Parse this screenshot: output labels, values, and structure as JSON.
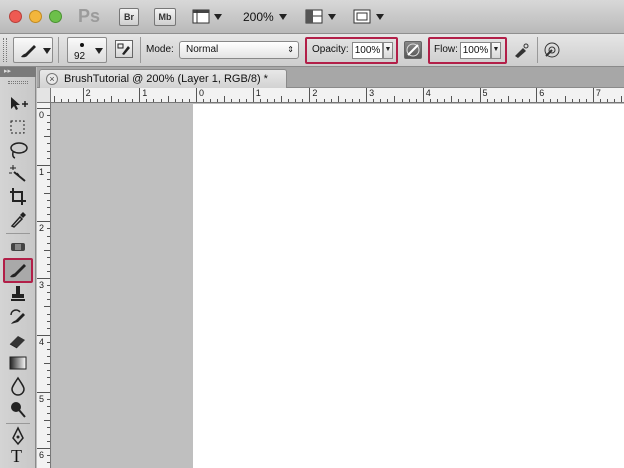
{
  "app": {
    "logo": "Ps",
    "bridge_label": "Br",
    "minibridge_label": "Mb",
    "zoom_level": "200%"
  },
  "colors": {
    "highlight": "#b21f48",
    "close_light": "#ee5a52",
    "minimize_light": "#f3b63c",
    "zoom_light": "#6cc04a"
  },
  "options": {
    "brush_size": "92",
    "mode_label": "Mode:",
    "mode_value": "Normal",
    "opacity_label": "Opacity:",
    "opacity_value": "100%",
    "flow_label": "Flow:",
    "flow_value": "100%"
  },
  "document": {
    "tab_title": "BrushTutorial @ 200% (Layer 1, RGB/8) *",
    "close_glyph": "×"
  },
  "rulers": {
    "horizontal": [
      "2",
      "1",
      "0",
      "1",
      "2",
      "3",
      "4",
      "5",
      "6",
      "7"
    ],
    "vertical": [
      "0",
      "1",
      "2",
      "3",
      "4",
      "5",
      "6"
    ]
  },
  "tools": [
    {
      "name": "move",
      "icon": "move-icon"
    },
    {
      "name": "marquee",
      "icon": "marquee-icon"
    },
    {
      "name": "lasso",
      "icon": "lasso-icon"
    },
    {
      "name": "quick-selection",
      "icon": "magic-wand-icon"
    },
    {
      "name": "crop",
      "icon": "crop-icon"
    },
    {
      "name": "eyedropper",
      "icon": "eyedropper-icon"
    },
    {
      "name": "spot-healing",
      "icon": "bandage-icon"
    },
    {
      "name": "brush",
      "icon": "brush-icon",
      "active": true
    },
    {
      "name": "clone-stamp",
      "icon": "stamp-icon"
    },
    {
      "name": "history-brush",
      "icon": "history-brush-icon"
    },
    {
      "name": "eraser",
      "icon": "eraser-icon"
    },
    {
      "name": "gradient",
      "icon": "gradient-icon"
    },
    {
      "name": "blur",
      "icon": "blur-icon"
    },
    {
      "name": "dodge",
      "icon": "dodge-icon"
    },
    {
      "name": "pen",
      "icon": "pen-icon"
    },
    {
      "name": "type",
      "icon": "type-icon",
      "glyph": "T"
    }
  ]
}
